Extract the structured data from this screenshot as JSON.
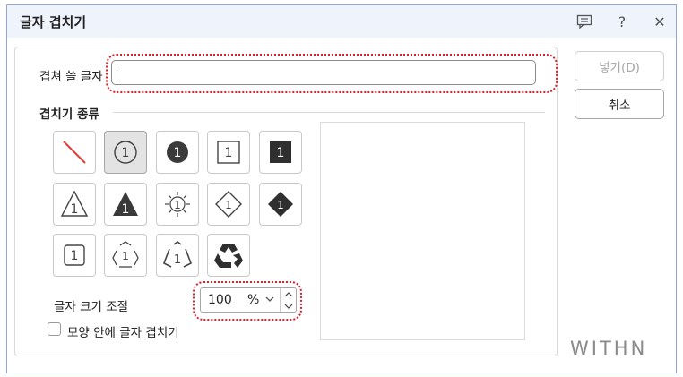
{
  "dialog": {
    "title": "글자 겹치기",
    "comment_icon": "comment-icon",
    "help_label": "?",
    "close_label": "✕"
  },
  "form": {
    "overlap_text_label": "겹쳐 쓸 글자",
    "overlap_text_value": "",
    "section_title": "겹치기 종류",
    "size_label": "글자 크기 조절",
    "size_value": "100",
    "size_unit": "%",
    "inside_shape_label": "모양 안에 글자 겹치기",
    "inside_shape_checked": false
  },
  "shapes": [
    {
      "name": "none-slash",
      "selected": false
    },
    {
      "name": "circle-outline",
      "selected": true
    },
    {
      "name": "circle-filled",
      "selected": false
    },
    {
      "name": "square-outline",
      "selected": false
    },
    {
      "name": "square-filled",
      "selected": false
    },
    {
      "name": "triangle-outline",
      "selected": false
    },
    {
      "name": "triangle-filled",
      "selected": false
    },
    {
      "name": "sun-burst",
      "selected": false
    },
    {
      "name": "diamond-outline",
      "selected": false
    },
    {
      "name": "diamond-filled",
      "selected": false
    },
    {
      "name": "rounded-square-outline",
      "selected": false
    },
    {
      "name": "recycle-outline-1",
      "selected": false
    },
    {
      "name": "recycle-triangle",
      "selected": false
    },
    {
      "name": "recycle-filled",
      "selected": false
    }
  ],
  "shape_glyph": "1",
  "buttons": {
    "insert_label": "넣기(D)",
    "insert_enabled": false,
    "cancel_label": "취소"
  },
  "brand": {
    "logo": "WITHN"
  },
  "colors": {
    "accent_dotted": "#d9202c",
    "titlebar": "#eef3fc",
    "dialog_border": "#8fa6d6"
  }
}
